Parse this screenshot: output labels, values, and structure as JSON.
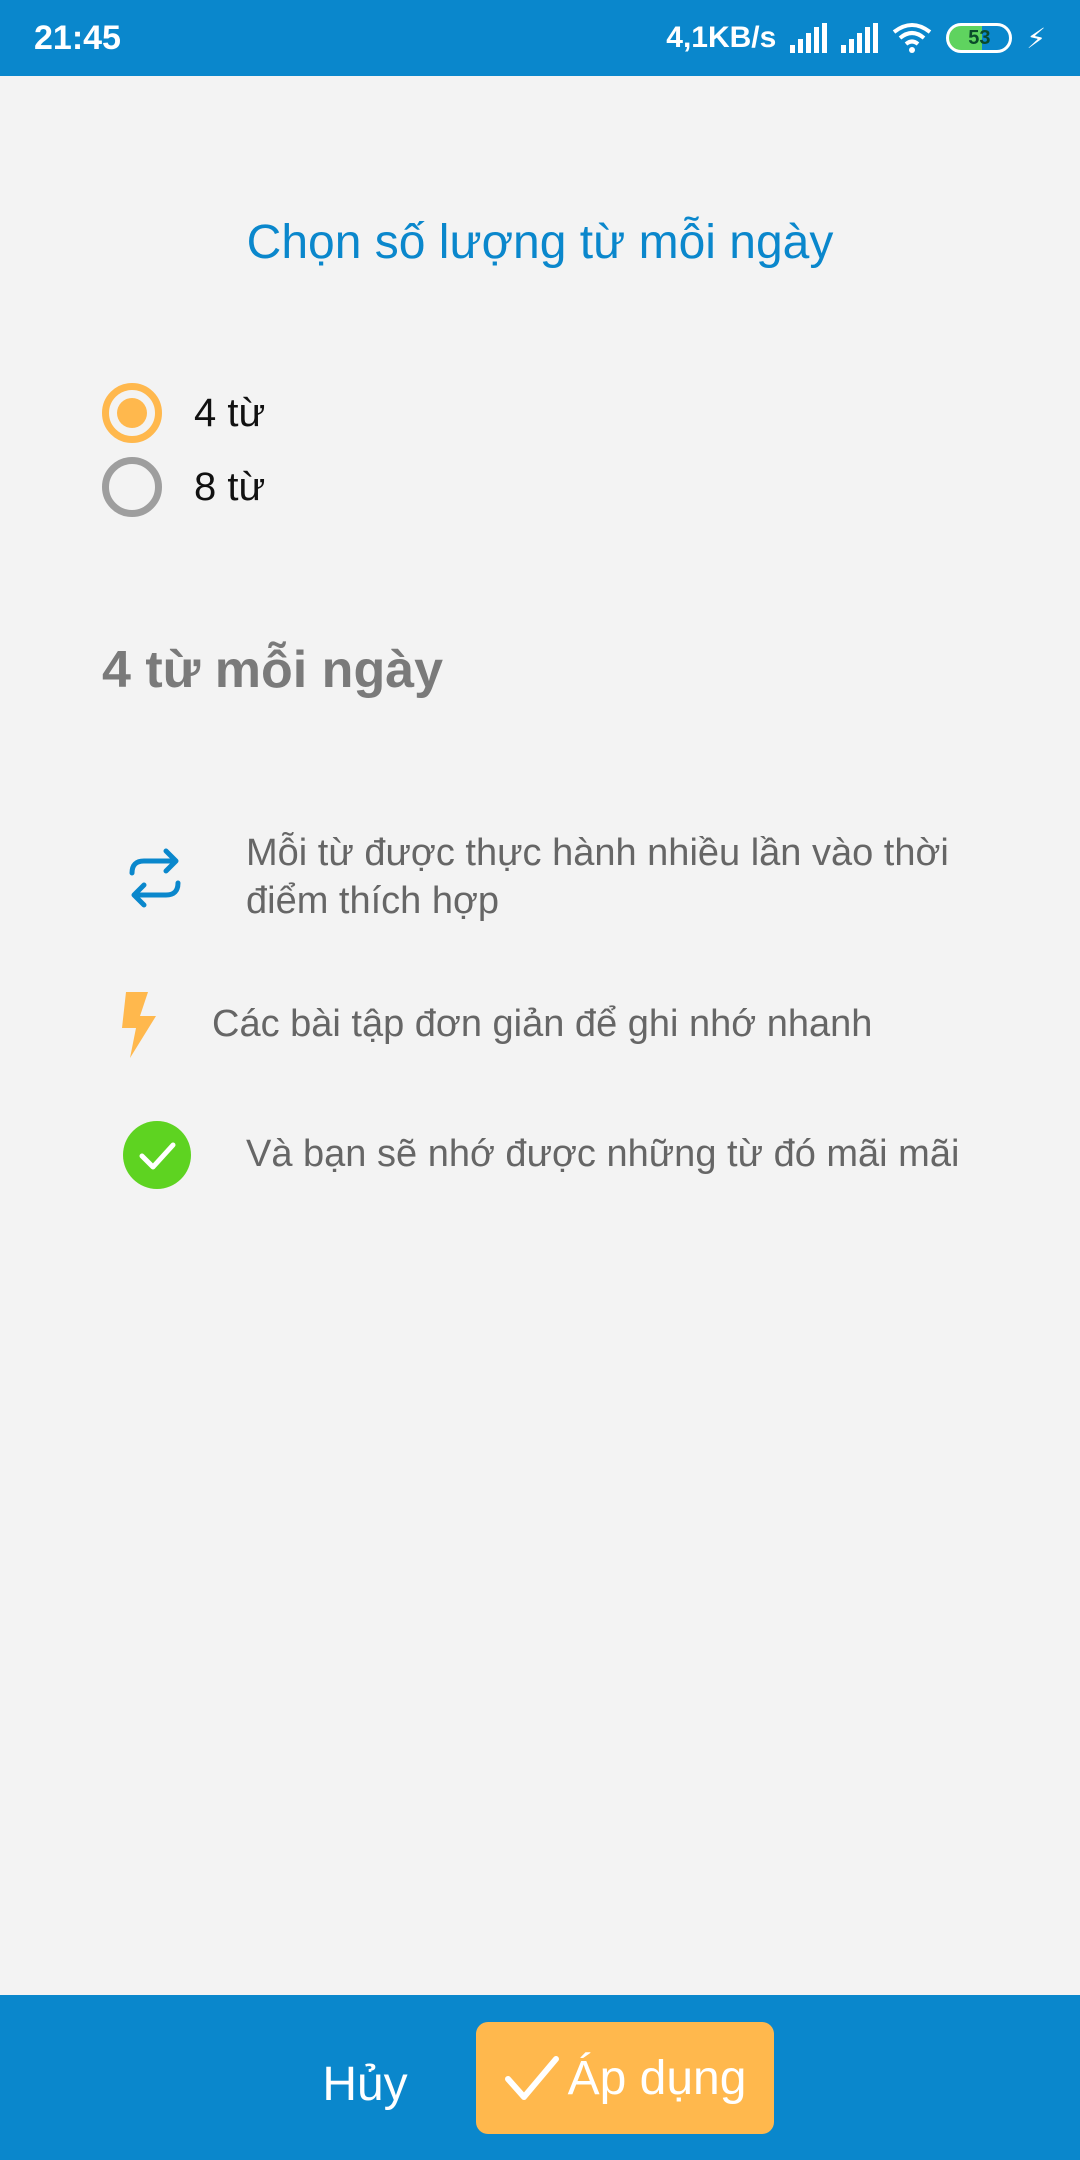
{
  "status_bar": {
    "time": "21:45",
    "speed": "4,1KB/s",
    "battery": "53"
  },
  "title": "Chọn số lượng từ mỗi ngày",
  "options": [
    {
      "label": "4 từ",
      "selected": true
    },
    {
      "label": "8 từ",
      "selected": false
    }
  ],
  "selected_summary": "4 từ mỗi ngày",
  "features": [
    {
      "icon": "repeat-icon",
      "text_line1": "Mỗi từ được thực hành nhiều lần vào thời",
      "text_line2": "điểm thích hợp"
    },
    {
      "icon": "lightning-icon",
      "text": "Các bài tập đơn giản để ghi nhớ nhanh"
    },
    {
      "icon": "check-circle-icon",
      "text": "Và bạn sẽ nhớ được những từ đó mãi mãi"
    }
  ],
  "bottom_bar": {
    "cancel_label": "Hủy",
    "apply_label": "Áp dụng"
  },
  "colors": {
    "primary": "#0a87cc",
    "accent": "#ffb84d",
    "success": "#5ed321"
  }
}
